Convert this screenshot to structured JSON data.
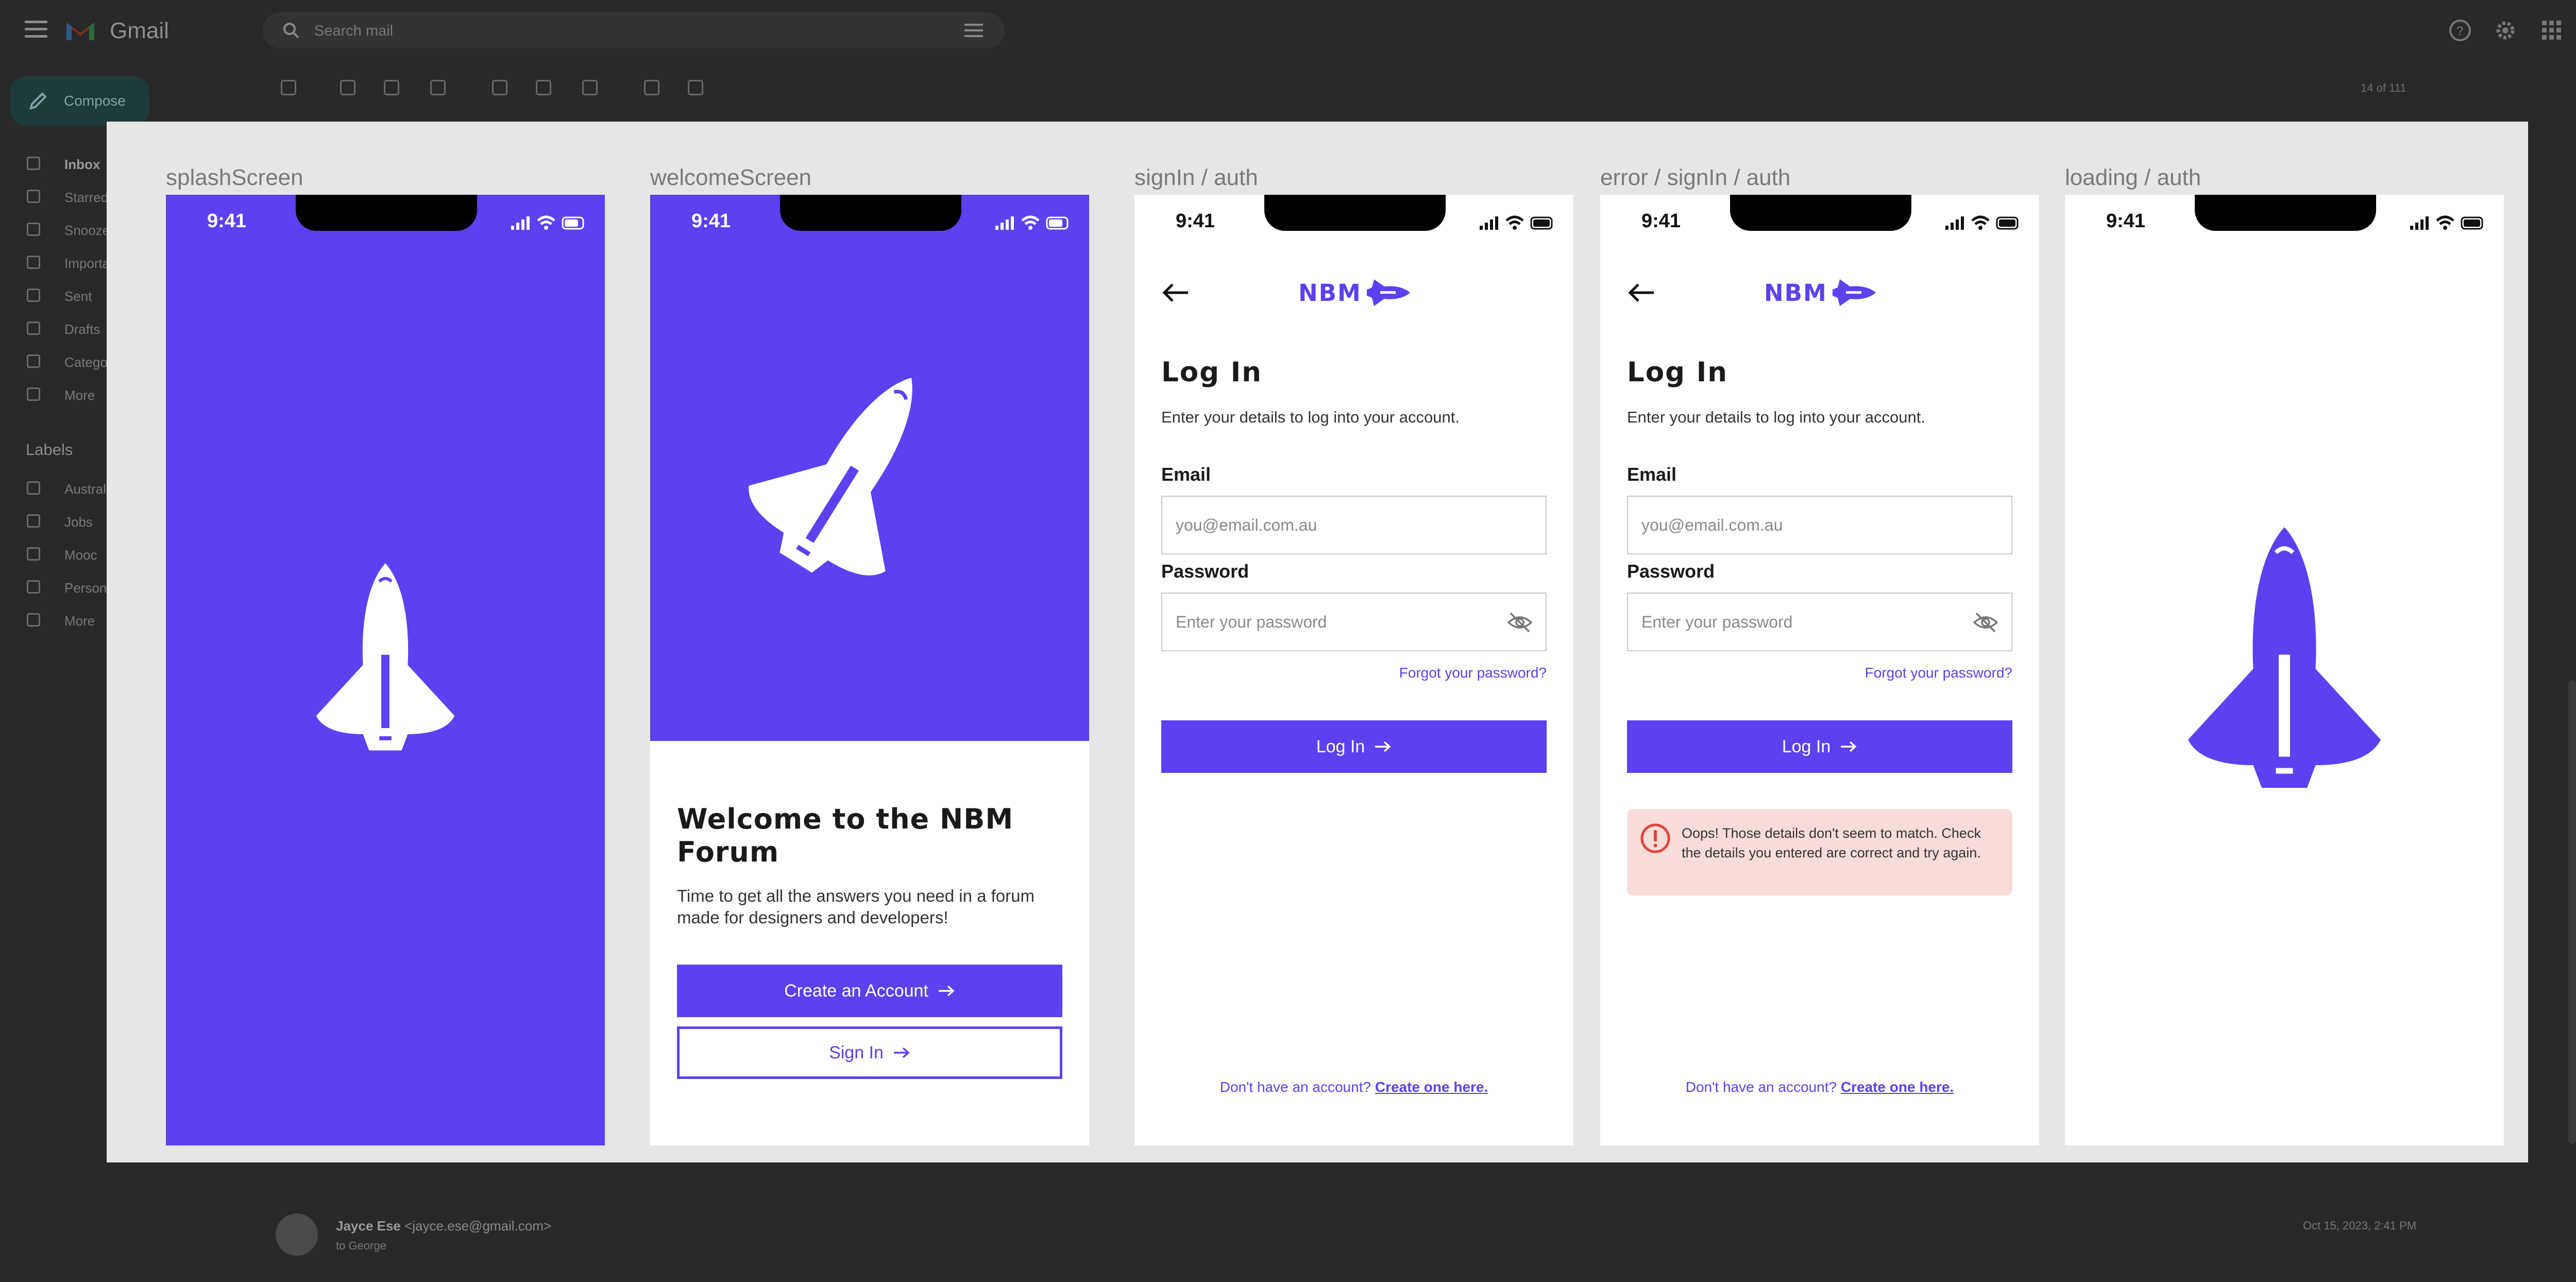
{
  "gmail": {
    "app_name": "Gmail",
    "search_placeholder": "Search mail",
    "compose_label": "Compose",
    "nav": [
      "Inbox",
      "Starred",
      "Snoozed",
      "Important",
      "Sent",
      "Drafts",
      "Categories",
      "More"
    ],
    "labels_title": "Labels",
    "labels": [
      "Australia",
      "Jobs",
      "Mooc",
      "Personal",
      "More"
    ],
    "page_count": "14 of 111",
    "sender_name": "Jayce Ese",
    "sender_email": "<jayce.ese@gmail.com>",
    "to_line": "to George",
    "date": "Oct 15, 2023, 2:41 PM"
  },
  "frames": [
    {
      "title": "splashScreen",
      "time": "9:41"
    },
    {
      "title": "welcomeScreen",
      "time": "9:41"
    },
    {
      "title": "signIn / auth",
      "time": "9:41"
    },
    {
      "title": "error / signIn / auth",
      "time": "9:41"
    },
    {
      "title": "loading / auth",
      "time": "9:41"
    }
  ],
  "welcome": {
    "title": "Welcome to the NBM Forum",
    "description": "Time to get all the answers you need in a forum made for designers and developers!",
    "create_account": "Create an Account",
    "sign_in": "Sign In"
  },
  "login": {
    "brand": "NBM",
    "title": "Log In",
    "description": "Enter your details to log into your account.",
    "email_label": "Email",
    "email_placeholder": "you@email.com.au",
    "password_label": "Password",
    "password_placeholder": "Enter your password",
    "forgot": "Forgot your password?",
    "button": "Log In",
    "footer_text": "Don't have an account?",
    "footer_link": "Create one here.",
    "error_message": "Oops! Those details don't seem to match. Check the details you entered are correct and try again."
  },
  "colors": {
    "brand_purple": "#5b41f0",
    "error_bg": "#f8dcd9",
    "error_red": "#e0453a"
  }
}
